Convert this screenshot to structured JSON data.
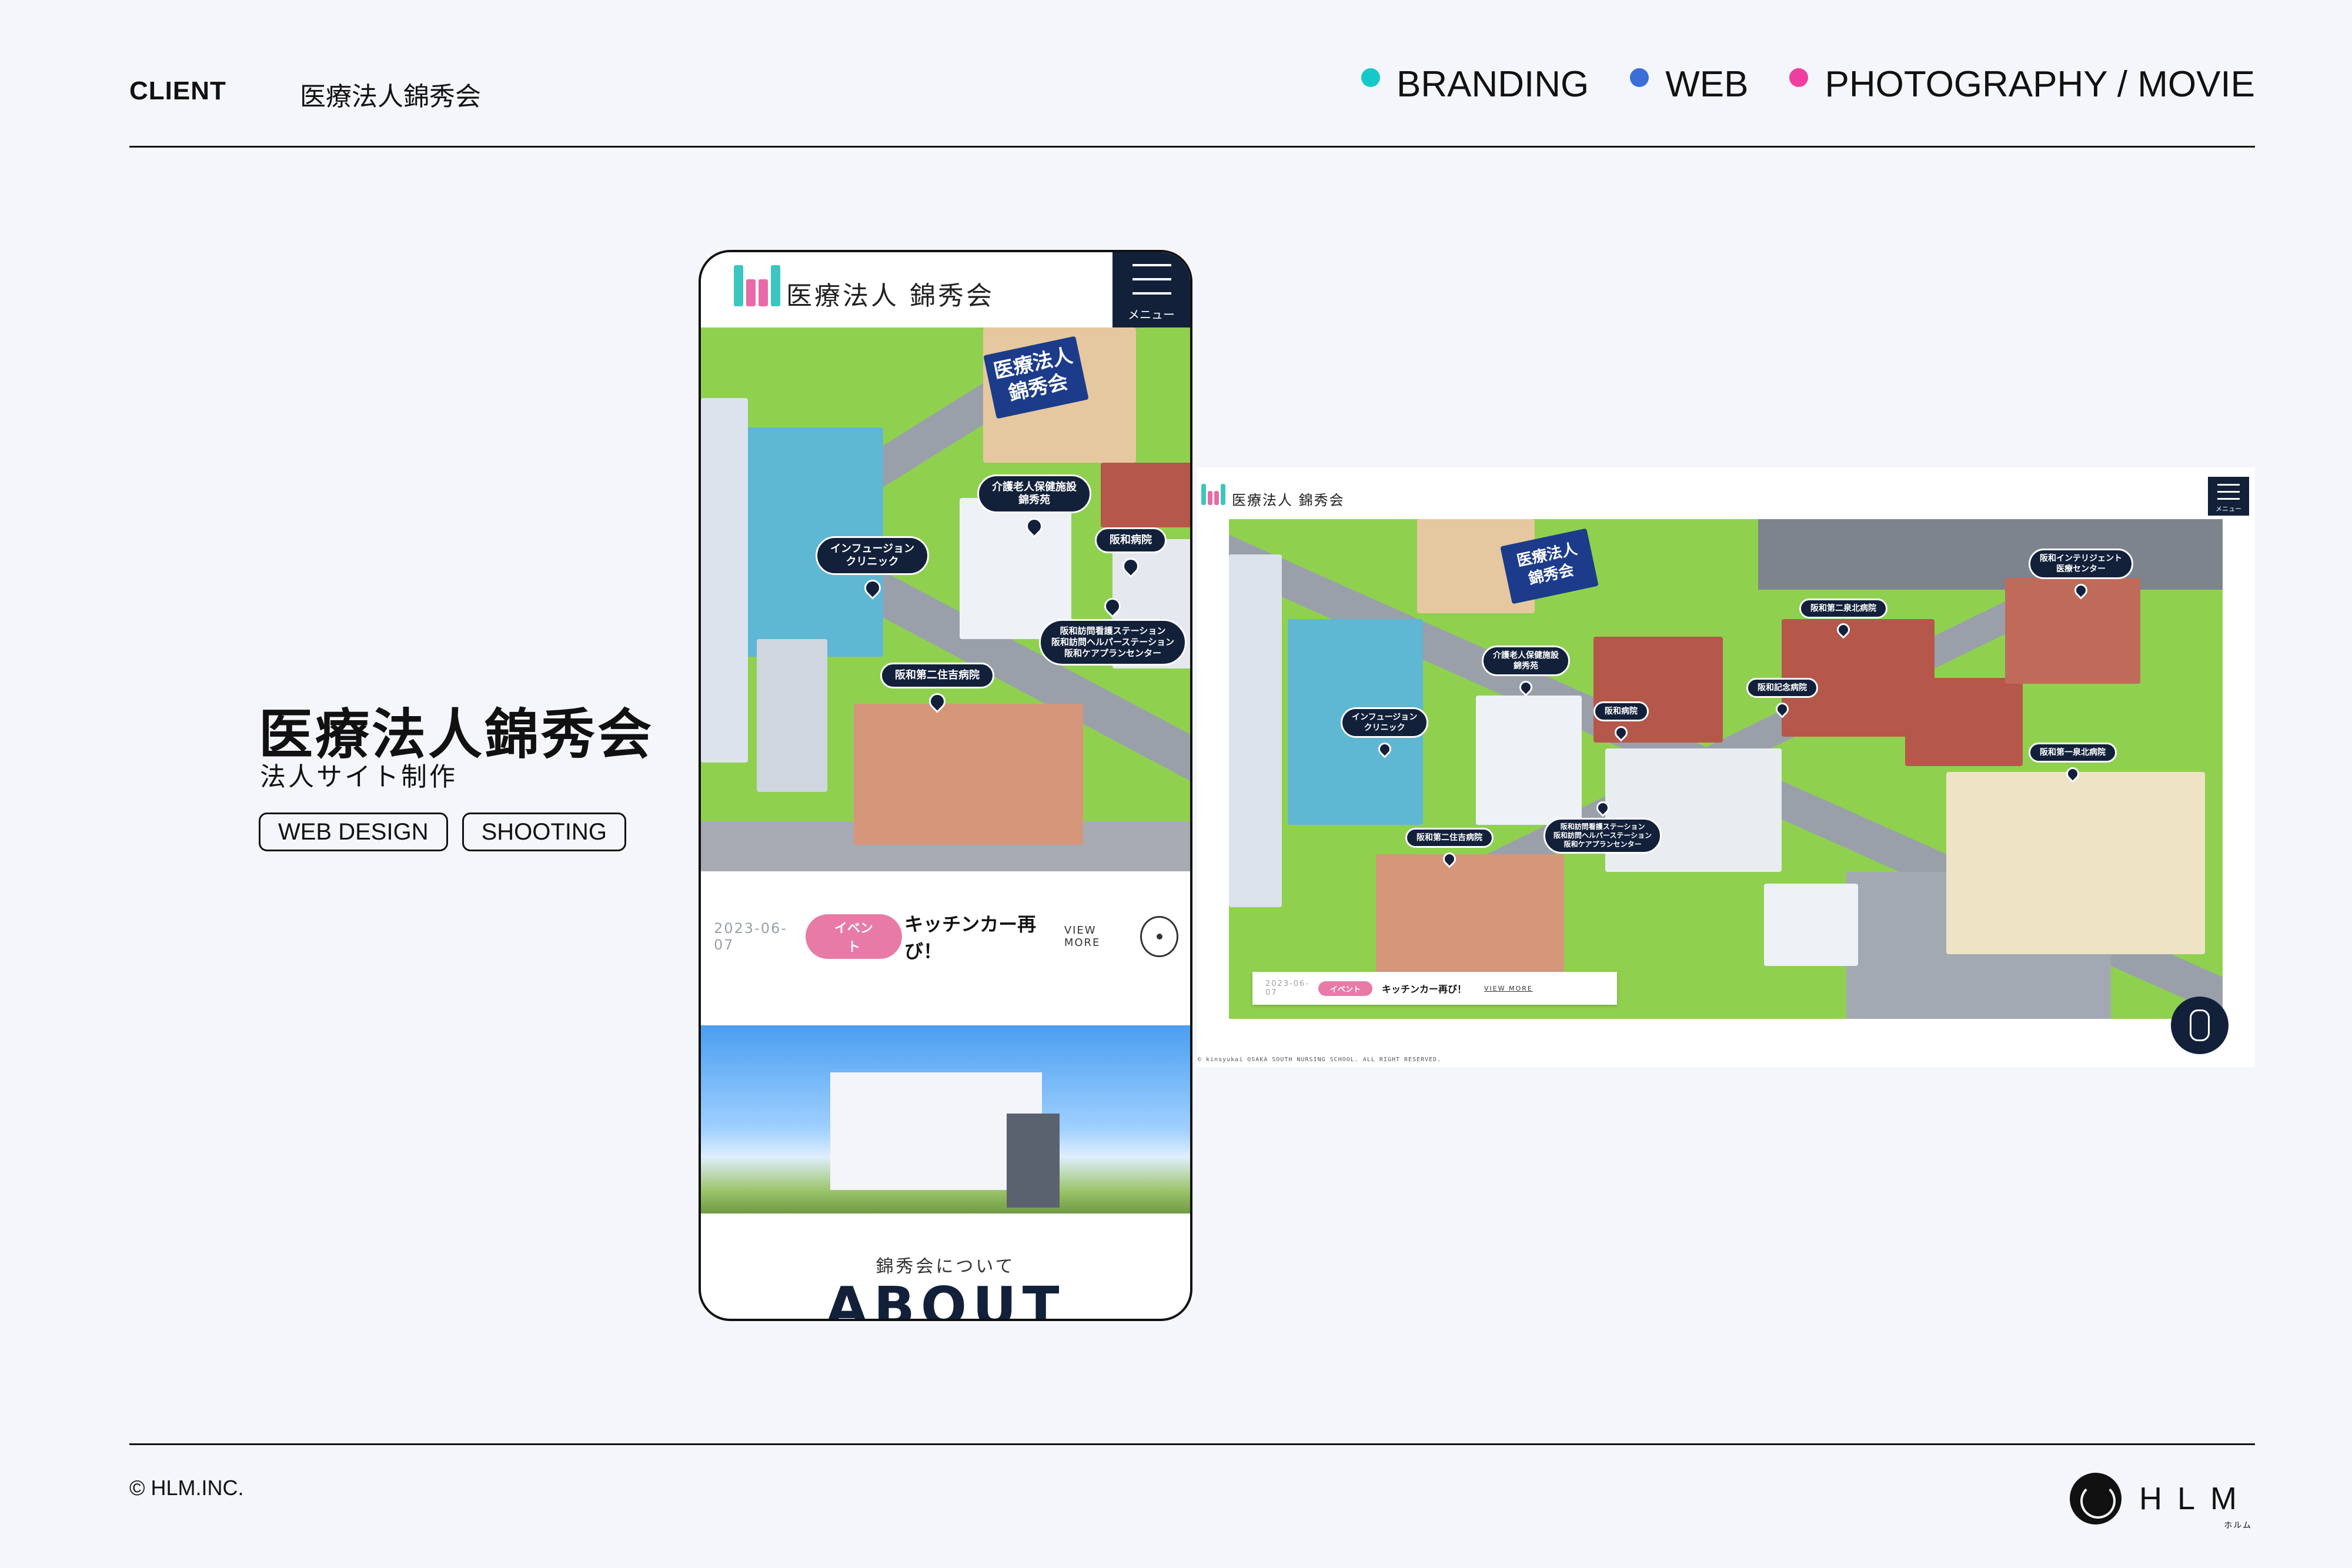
{
  "header": {
    "client_label": "CLIENT",
    "client_name": "医療法人錦秀会",
    "categories": [
      {
        "label": "BRANDING",
        "color": "#17c8c8"
      },
      {
        "label": "WEB",
        "color": "#3a6fd8"
      },
      {
        "label": "PHOTOGRAPHY / MOVIE",
        "color": "#ee3fa0"
      }
    ]
  },
  "project": {
    "title": "医療法人錦秀会",
    "subtitle": "法人サイト制作",
    "tags": [
      "WEB DESIGN",
      "SHOOTING"
    ]
  },
  "site": {
    "logo_text": "医療法人 錦秀会",
    "menu_label": "メニュー",
    "banner": "医療法人\n錦秀会",
    "news": {
      "date": "2023-06-07",
      "category": "イベント",
      "headline": "キッチンカー再び！",
      "more": "VIEW MORE"
    },
    "about_sub": "錦秀会について",
    "about_title": "ABOUT",
    "copyright": "© kinsyukai OSAKA SOUTH NURSING SCHOOL. ALL RIGHT RESERVED."
  },
  "mobile_pins": [
    {
      "label": "介護老人保健施設\n錦秀苑"
    },
    {
      "label": "インフュージョン\nクリニック"
    },
    {
      "label": "阪和病院"
    },
    {
      "label": "阪和第二住吉病院"
    },
    {
      "label": "阪和訪問看護ステーション\n阪和訪問ヘルパーステーション\n阪和ケアプランセンター"
    }
  ],
  "desktop_pins": [
    {
      "label": "阪和インテリジェント\n医療センター"
    },
    {
      "label": "阪和第二泉北病院"
    },
    {
      "label": "介護老人保健施設\n錦秀苑"
    },
    {
      "label": "阪和記念病院"
    },
    {
      "label": "阪和病院"
    },
    {
      "label": "インフュージョン\nクリニック"
    },
    {
      "label": "阪和第一泉北病院"
    },
    {
      "label": "阪和第二住吉病院"
    },
    {
      "label": "阪和訪問看護ステーション\n阪和訪問ヘルパーステーション\n阪和ケアプランセンター"
    }
  ],
  "footer": {
    "copyright": "© HLM.INC.",
    "brand": "HLM",
    "brand_kana": "ホルム"
  }
}
